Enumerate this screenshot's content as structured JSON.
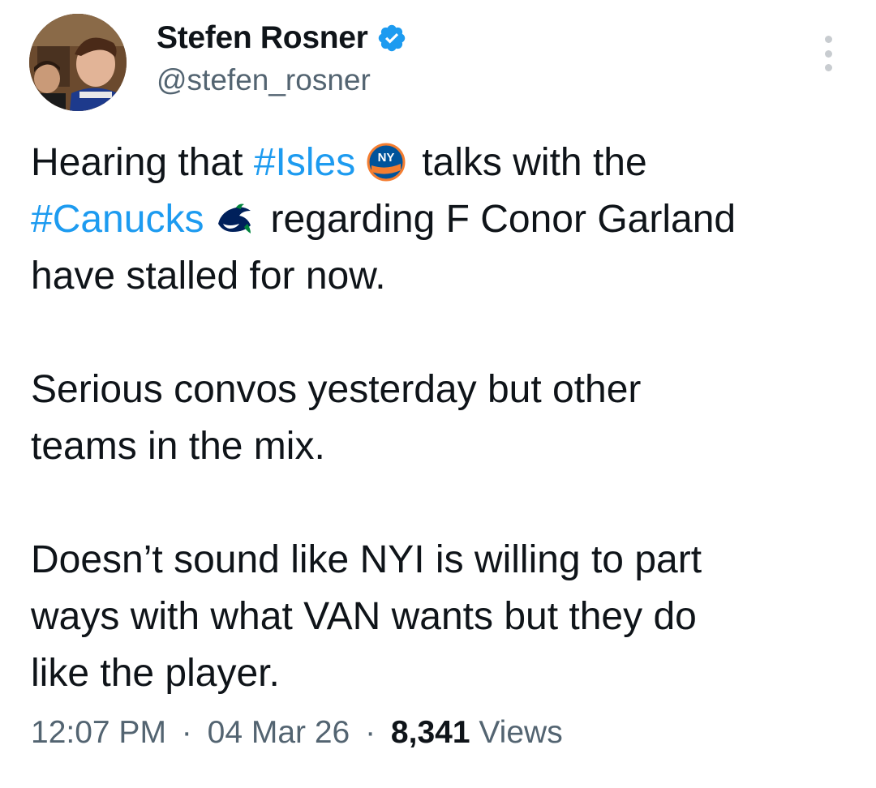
{
  "author": {
    "display_name": "Stefen Rosner",
    "handle": "@stefen_rosner",
    "verified_icon": "verified-badge-icon",
    "avatar_icon": "profile-photo"
  },
  "tweet": {
    "line1_a": "Hearing that ",
    "hashtag_isles": "#Isles",
    "line1_b": "talks with the",
    "hashtag_canucks": "#Canucks",
    "line2_b": "regarding F Conor Garland",
    "line3": "have stalled for now.",
    "para2_line1": "Serious convos yesterday but other",
    "para2_line2": "teams in the mix.",
    "para3_line1": "Doesn’t sound like NYI is willing to part",
    "para3_line2": "ways with what VAN wants but they do",
    "para3_line3": "like the player.",
    "isles_emoji_icon": "islanders-logo-icon",
    "canucks_emoji_icon": "canucks-orca-logo-icon"
  },
  "meta": {
    "time": "12:07 PM",
    "separator": "·",
    "date": "04 Mar 26",
    "views_count": "8,341",
    "views_label": "Views"
  },
  "colors": {
    "hashtag": "#1d9bf0",
    "verified": "#1d9bf0",
    "secondary_text": "#536471",
    "primary_text": "#0f1419"
  }
}
